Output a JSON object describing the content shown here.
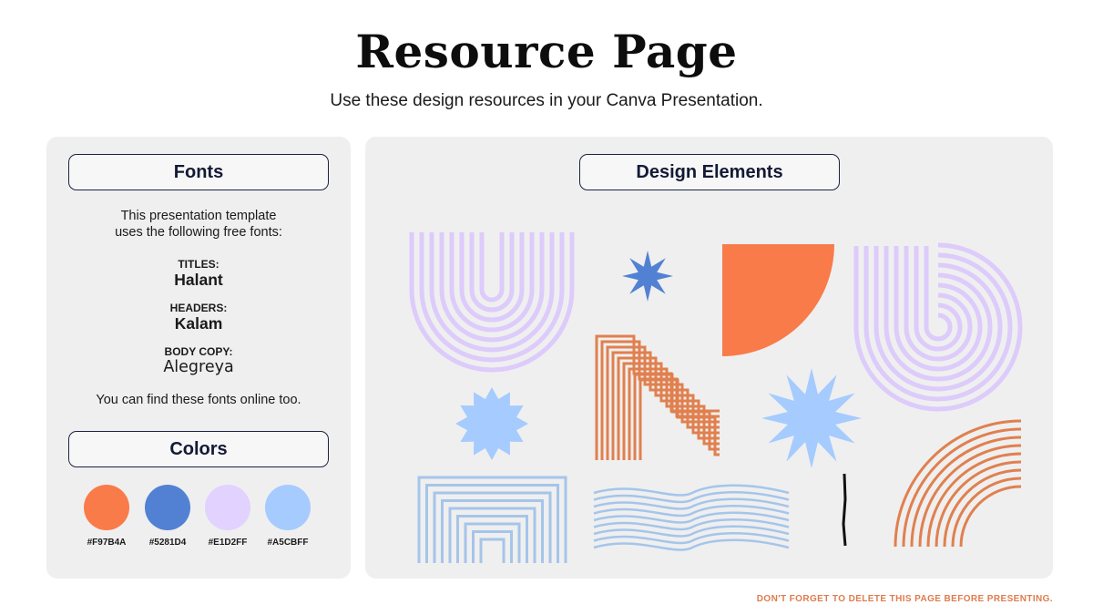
{
  "page": {
    "title": "Resource Page",
    "subtitle": "Use these design resources in your Canva Presentation."
  },
  "fonts_panel": {
    "heading": "Fonts",
    "intro_line1": "This presentation template",
    "intro_line2": "uses the following free fonts:",
    "titles_label": "TITLES:",
    "titles_font": "Halant",
    "headers_label": "HEADERS:",
    "headers_font": "Kalam",
    "body_label": "BODY COPY:",
    "body_font": "Alegreya",
    "online_note": "You can find these fonts online too."
  },
  "colors_panel": {
    "heading": "Colors",
    "swatches": [
      {
        "hex": "#F97B4A",
        "label": "#F97B4A"
      },
      {
        "hex": "#5281D4",
        "label": "#5281D4"
      },
      {
        "hex": "#E1D2FF",
        "label": "#E1D2FF"
      },
      {
        "hex": "#A5CBFF",
        "label": "#A5CBFF"
      }
    ]
  },
  "design_panel": {
    "heading": "Design Elements",
    "elements": [
      "lavender-arch-lines",
      "blue-star-small",
      "orange-quarter-circle",
      "lavender-b-lines",
      "orange-step-lines",
      "light-blue-burst-left",
      "light-blue-burst-right",
      "blue-nested-arch-lines",
      "blue-wave-lines",
      "black-vertical-line",
      "orange-arc-lines"
    ],
    "colors": {
      "lavender": "#dccbfb",
      "orange": "#f97b4a",
      "orange_line": "#e0804f",
      "blue": "#5281d4",
      "light_blue": "#a5cbff",
      "line_blue": "#a5c5ea"
    }
  },
  "footer": {
    "note": "DON'T FORGET TO DELETE THIS PAGE BEFORE PRESENTING."
  }
}
